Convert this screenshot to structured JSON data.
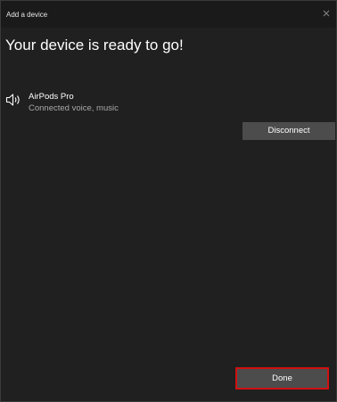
{
  "window": {
    "title": "Add a device",
    "close_icon": "close-icon"
  },
  "main": {
    "heading": "Your device is ready to go!"
  },
  "device": {
    "icon": "speaker-icon",
    "name": "AirPods Pro",
    "status": "Connected voice, music",
    "disconnect_label": "Disconnect"
  },
  "footer": {
    "done_label": "Done"
  },
  "colors": {
    "background": "#202020",
    "titlebar": "#1a1a1a",
    "button": "#4c4c4c",
    "secondary_text": "#a8a8a8",
    "highlight_border": "#d01010"
  }
}
